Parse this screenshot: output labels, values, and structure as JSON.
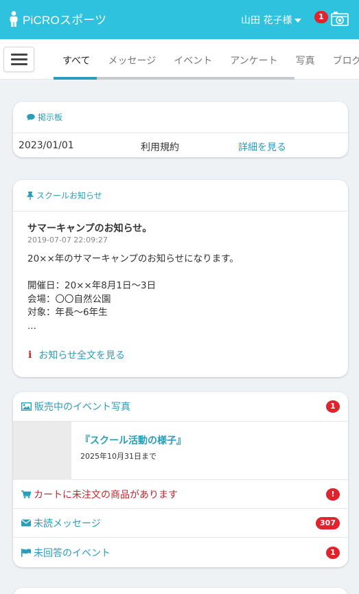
{
  "header": {
    "brand": "PiCROスポーツ",
    "user_name": "山田 花子様",
    "notification_count": "1"
  },
  "tabs": [
    {
      "label": "すべて",
      "active": true
    },
    {
      "label": "メッセージ"
    },
    {
      "label": "イベント"
    },
    {
      "label": "アンケート"
    },
    {
      "label": "写真"
    },
    {
      "label": "ブログ"
    }
  ],
  "bulletin": {
    "heading": "掲示板",
    "date": "2023/01/01",
    "title": "利用規約",
    "link": "詳細を見る"
  },
  "notice": {
    "heading": "スクールお知らせ",
    "title": "サマーキャンプのお知らせ。",
    "datetime": "2019-07-07 22:09:27",
    "lines": [
      "20××年のサマーキャンプのお知らせになります。",
      "",
      "開催日：20××年8月1日〜3日",
      "会場：〇〇自然公園",
      "対象：年長〜6年生",
      "..."
    ],
    "link": "お知らせ全文を見る"
  },
  "photos": {
    "heading": "販売中のイベント写真",
    "heading_badge": "1",
    "event_title": "『スクール活動の様子』",
    "event_until": "2025年10月31日まで"
  },
  "alerts": {
    "cart_text": "カートに未注文の商品があります",
    "cart_badge": "!",
    "unread_label": "未読メッセージ",
    "unread_count": "307",
    "unanswered_label": "未回答のイベント",
    "unanswered_count": "1"
  },
  "colors": {
    "header_bg": "#2fc2de",
    "accent": "#2a9db8",
    "alert": "#c0272d",
    "badge": "#e0232d"
  }
}
